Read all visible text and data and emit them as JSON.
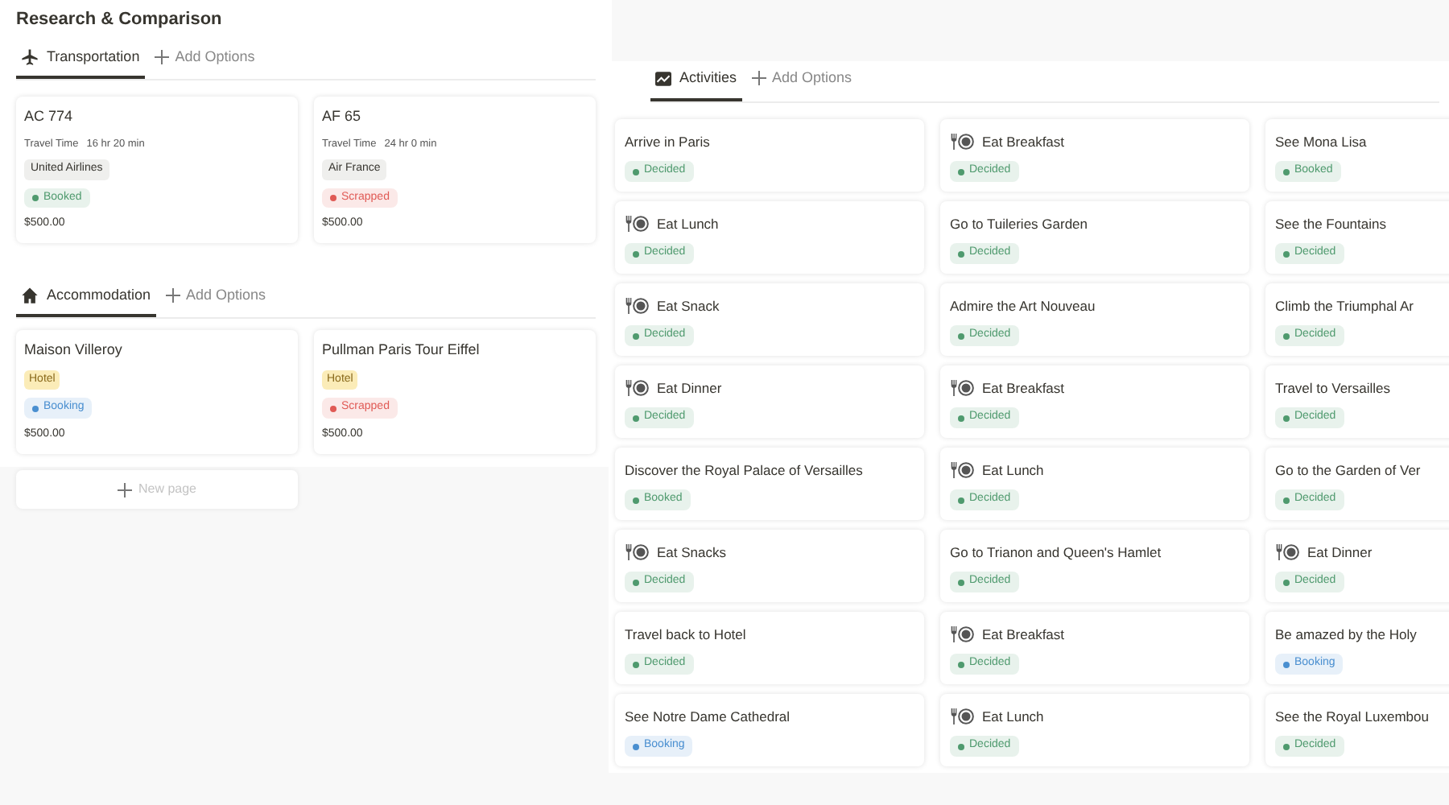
{
  "title": "Research & Comparison",
  "transportation": {
    "tab": {
      "label": "Transportation",
      "selected": true
    },
    "add_label": "Add Options",
    "cards": [
      {
        "name": "AC 774",
        "travel_label": "Travel Time",
        "travel_time": "16 hr 20 min",
        "airline": "United Airlines",
        "status": {
          "label": "Booked",
          "color": "#4f9a6e"
        },
        "price": "$500.00"
      },
      {
        "name": "AF 65",
        "travel_label": "Travel Time",
        "travel_time": "24 hr 0 min",
        "airline": "Air France",
        "status": {
          "label": "Scrapped",
          "color": "#e05a55"
        },
        "price": "$500.00"
      }
    ]
  },
  "accommodation": {
    "tab": {
      "label": "Accommodation",
      "selected": true
    },
    "add_label": "Add Options",
    "cards": [
      {
        "name": "Maison Villeroy",
        "type": "Hotel",
        "status": {
          "label": "Booking",
          "color": "#4a8fd0"
        },
        "price": "$500.00"
      },
      {
        "name": "Pullman Paris Tour Eiffel",
        "type": "Hotel",
        "status": {
          "label": "Scrapped",
          "color": "#e05a55"
        },
        "price": "$500.00"
      }
    ],
    "new_page": "New page"
  },
  "activities": {
    "tab": {
      "label": "Activities",
      "selected": true
    },
    "add_label": "Add Options",
    "cards": [
      {
        "kind": "plain",
        "name": "Arrive in Paris",
        "status": {
          "label": "Decided",
          "color": "#4f9a6e"
        }
      },
      {
        "kind": "meal",
        "name": "Eat Breakfast",
        "status": {
          "label": "Decided",
          "color": "#4f9a6e"
        }
      },
      {
        "kind": "plain",
        "name": "See Mona Lisa",
        "status": {
          "label": "Booked",
          "color": "#4f9a6e"
        }
      },
      {
        "kind": "meal",
        "name": "Eat Lunch",
        "status": {
          "label": "Decided",
          "color": "#4f9a6e"
        }
      },
      {
        "kind": "plain",
        "name": "Go to Tuileries Garden",
        "status": {
          "label": "Decided",
          "color": "#4f9a6e"
        }
      },
      {
        "kind": "plain",
        "name": "See the Fountains",
        "status": {
          "label": "Decided",
          "color": "#4f9a6e"
        }
      },
      {
        "kind": "meal",
        "name": "Eat Snack",
        "status": {
          "label": "Decided",
          "color": "#4f9a6e"
        }
      },
      {
        "kind": "plain",
        "name": "Admire the Art Nouveau",
        "status": {
          "label": "Decided",
          "color": "#4f9a6e"
        }
      },
      {
        "kind": "plain",
        "name": "Climb the Triumphal Ar",
        "status": {
          "label": "Decided",
          "color": "#4f9a6e"
        }
      },
      {
        "kind": "meal",
        "name": "Eat Dinner",
        "status": {
          "label": "Decided",
          "color": "#4f9a6e"
        }
      },
      {
        "kind": "meal",
        "name": "Eat Breakfast",
        "status": {
          "label": "Decided",
          "color": "#4f9a6e"
        }
      },
      {
        "kind": "plain",
        "name": "Travel to Versailles",
        "status": {
          "label": "Decided",
          "color": "#4f9a6e"
        }
      },
      {
        "kind": "plain",
        "name": "Discover the Royal Palace of Versailles",
        "status": {
          "label": "Booked",
          "color": "#4f9a6e"
        }
      },
      {
        "kind": "meal",
        "name": "Eat Lunch",
        "status": {
          "label": "Decided",
          "color": "#4f9a6e"
        }
      },
      {
        "kind": "plain",
        "name": "Go to the Garden of Ver",
        "status": {
          "label": "Decided",
          "color": "#4f9a6e"
        }
      },
      {
        "kind": "meal",
        "name": "Eat Snacks",
        "status": {
          "label": "Decided",
          "color": "#4f9a6e"
        }
      },
      {
        "kind": "plain",
        "name": "Go to Trianon and Queen's Hamlet",
        "status": {
          "label": "Decided",
          "color": "#4f9a6e"
        }
      },
      {
        "kind": "meal",
        "name": "Eat Dinner",
        "status": {
          "label": "Decided",
          "color": "#4f9a6e"
        }
      },
      {
        "kind": "plain",
        "name": "Travel back to Hotel",
        "status": {
          "label": "Decided",
          "color": "#4f9a6e"
        }
      },
      {
        "kind": "meal",
        "name": "Eat Breakfast",
        "status": {
          "label": "Decided",
          "color": "#4f9a6e"
        }
      },
      {
        "kind": "plain",
        "name": "Be amazed by the Holy",
        "status": {
          "label": "Booking",
          "color": "#4a8fd0"
        }
      },
      {
        "kind": "plain",
        "name": "See Notre Dame Cathedral",
        "status": {
          "label": "Booking",
          "color": "#4a8fd0"
        }
      },
      {
        "kind": "meal",
        "name": "Eat Lunch",
        "status": {
          "label": "Decided",
          "color": "#4f9a6e"
        }
      },
      {
        "kind": "plain",
        "name": "See the Royal Luxembou",
        "status": {
          "label": "Decided",
          "color": "#4f9a6e"
        }
      }
    ]
  }
}
